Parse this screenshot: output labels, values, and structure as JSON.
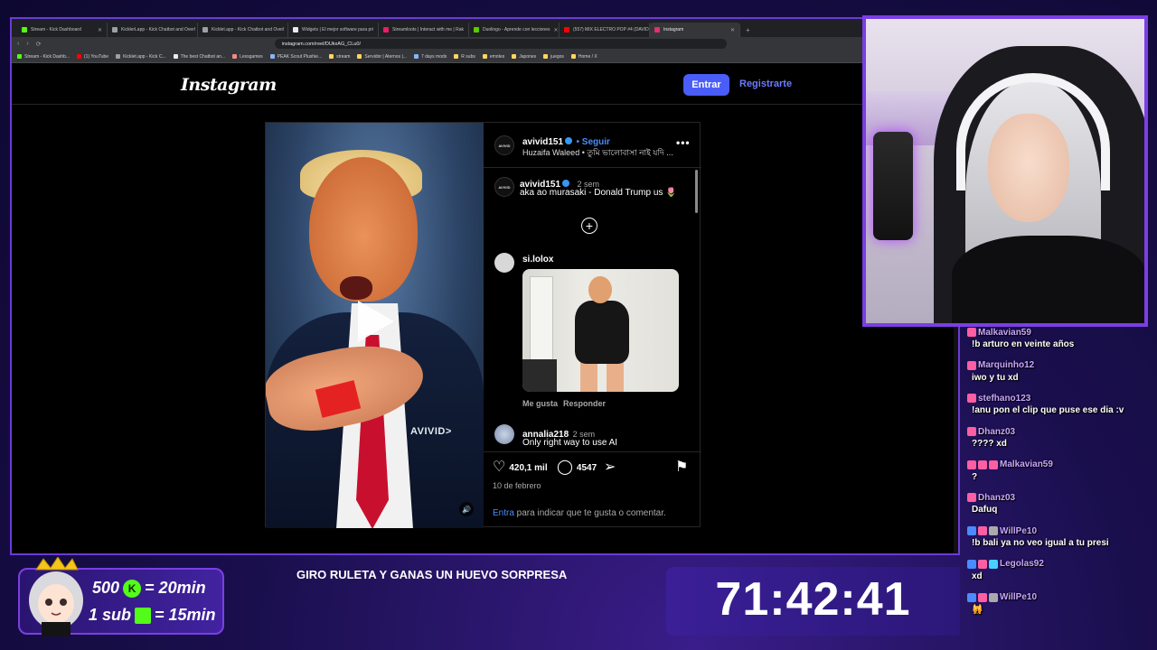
{
  "browser": {
    "tabs": [
      {
        "label": "Stream - Kick Dashboard",
        "color": "#53fc18"
      },
      {
        "label": "KicklerLapp - Kick Chatbot and Overl",
        "color": "#9aa0a6"
      },
      {
        "label": "Kicklet.app - Kick Chatbot and Overl",
        "color": "#9aa0a6"
      },
      {
        "label": "Widgets | El mejor software para pri",
        "color": "#e8eaed"
      },
      {
        "label": "Streamloots | Interact with me | Rak",
        "color": "#e91e63"
      },
      {
        "label": "Duolingo - Aprende con lecciones",
        "color": "#58cc02"
      },
      {
        "label": "(557) MIX ELECTRO POP #4 (DAVID",
        "color": "#ff0000"
      },
      {
        "label": "Instagram",
        "color": "#e1306c"
      }
    ],
    "url": "instagram.com/reel/DUkxAG_CLu0/",
    "bookmarks": [
      "Stream - Kick Dashb...",
      "(1) YouTube",
      "Kicklet.app - Kick C...",
      "The best Chatbot an...",
      "Lessgames",
      "PEAK Scout Plushie...",
      "stream",
      "Servidor | Aternos |...",
      "7 days mods",
      "R subs",
      "emotes",
      "Japones",
      "juegos",
      "Home / X"
    ]
  },
  "instagram": {
    "logo": "Instagram",
    "login_label": "Entrar",
    "signup_label": "Registrarte",
    "video_watermark": "AVIVID>",
    "post": {
      "author": "avivid151",
      "follow_label": "Seguir",
      "audio": "Huzaifa Waleed • তুমি ভালোবাসা নাই যদি ...",
      "avatar_text": "AVIVID",
      "caption_user": "avivid151",
      "caption_time": "2 sem",
      "caption_text": "aka ao murasaki - Donald Trump us 🌷",
      "comments": [
        {
          "user": "si.lolox",
          "like_label": "Me gusta",
          "reply_label": "Responder"
        },
        {
          "user": "annalia218",
          "time": "2 sem",
          "text": "Only right way to use AI"
        }
      ],
      "likes": "420,1 mil",
      "comments_count": "4547",
      "date": "10 de febrero",
      "login_prompt_link": "Entra",
      "login_prompt_rest": " para indicar que te gusta o comentar."
    }
  },
  "chat": [
    {
      "user": "Malkavian59",
      "text": "!b arturo en veinte años"
    },
    {
      "user": "Marquinho12",
      "text": "iwo y tu xd"
    },
    {
      "user": "stefhano123",
      "text": "!anu pon el clip que puse ese dia :v"
    },
    {
      "user": "Dhanz03",
      "text": "???? xd"
    },
    {
      "user": "Malkavian59",
      "text": "?"
    },
    {
      "user": "Dhanz03",
      "text": "Dafuq"
    },
    {
      "user": "WillPe10",
      "text": "!b bali ya no veo igual a tu presi"
    },
    {
      "user": "Legolas92",
      "text": "xd"
    },
    {
      "user": "WillPe10",
      "text": "🙀"
    }
  ],
  "promo": {
    "line1_left": "500",
    "line1_right": "= 20min",
    "line2_left": "1 sub",
    "line2_right": "= 15min",
    "kick_letter": "K"
  },
  "ticker": "GIRO RULETA Y GANAS UN HUEVO SORPRESA",
  "timer": "71:42:41",
  "colors": {
    "accent": "#7b3fe4",
    "ig_button": "#4a5df9",
    "kick_green": "#53fc18"
  }
}
